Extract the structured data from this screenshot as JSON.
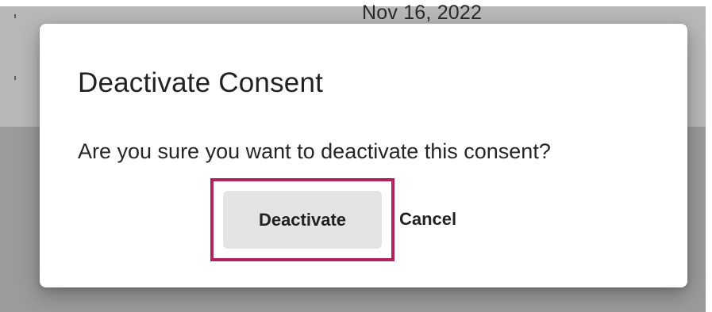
{
  "background": {
    "date_text": "Nov 16, 2022"
  },
  "dialog": {
    "title": "Deactivate Consent",
    "message": "Are you sure you want to deactivate this consent?",
    "primary_button_label": "Deactivate",
    "secondary_button_label": "Cancel"
  },
  "colors": {
    "focus_ring": "#b0235c",
    "primary_button_bg": "#e4e4e4",
    "overlay": "#9b9b9b",
    "dialog_bg": "#ffffff"
  }
}
